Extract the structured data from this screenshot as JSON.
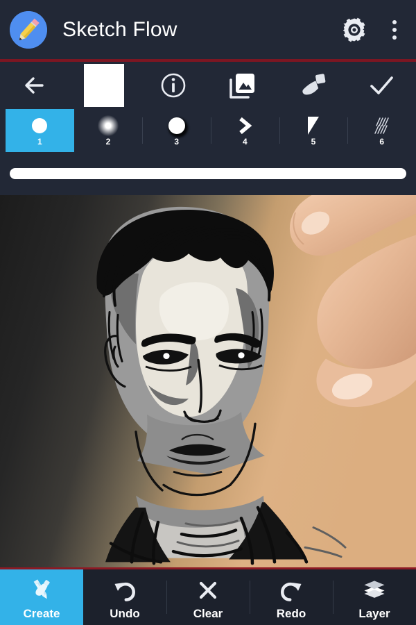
{
  "app": {
    "title": "Sketch Flow",
    "icon": "pencil-app-icon"
  },
  "colors": {
    "accent": "#33b2e8",
    "chrome": "#222836",
    "divider_red": "#7d1622",
    "swatch": "#d9a772",
    "icon": "#e9ecf2"
  },
  "titlebar": {
    "settings_icon": "gear-icon",
    "overflow_icon": "overflow-menu-icon"
  },
  "toolbar": {
    "items": [
      {
        "name": "back-button",
        "icon": "arrow-left-icon",
        "label": "Back"
      },
      {
        "name": "color-swatch-button",
        "icon": "color-swatch",
        "label": "Color"
      },
      {
        "name": "info-button",
        "icon": "info-icon",
        "label": "Info"
      },
      {
        "name": "gallery-button",
        "icon": "gallery-icon",
        "label": "Gallery"
      },
      {
        "name": "brush-button",
        "icon": "paintbrush-icon",
        "label": "Brush"
      },
      {
        "name": "confirm-button",
        "icon": "check-icon",
        "label": "Done"
      }
    ]
  },
  "brushes": {
    "selected": 1,
    "items": [
      {
        "number": "1",
        "icon": "solid-dot-brush"
      },
      {
        "number": "2",
        "icon": "soft-dot-brush"
      },
      {
        "number": "3",
        "icon": "shadow-dot-brush"
      },
      {
        "number": "4",
        "icon": "chevron-brush"
      },
      {
        "number": "5",
        "icon": "wedge-brush"
      },
      {
        "number": "6",
        "icon": "hatch-brush"
      }
    ]
  },
  "size_slider": {
    "name": "brush-size-slider",
    "fill_percent": 100
  },
  "canvas": {
    "artwork": "grayscale-portrait-sketch",
    "touch_pointer": "finger-touching-canvas"
  },
  "bottom_nav": {
    "selected": "Create",
    "items": [
      {
        "label": "Create",
        "icon": "pencil-brush-cross-icon"
      },
      {
        "label": "Undo",
        "icon": "undo-arrow-icon"
      },
      {
        "label": "Clear",
        "icon": "close-x-icon"
      },
      {
        "label": "Redo",
        "icon": "redo-arrow-icon"
      },
      {
        "label": "Layer",
        "icon": "layers-icon"
      }
    ]
  }
}
